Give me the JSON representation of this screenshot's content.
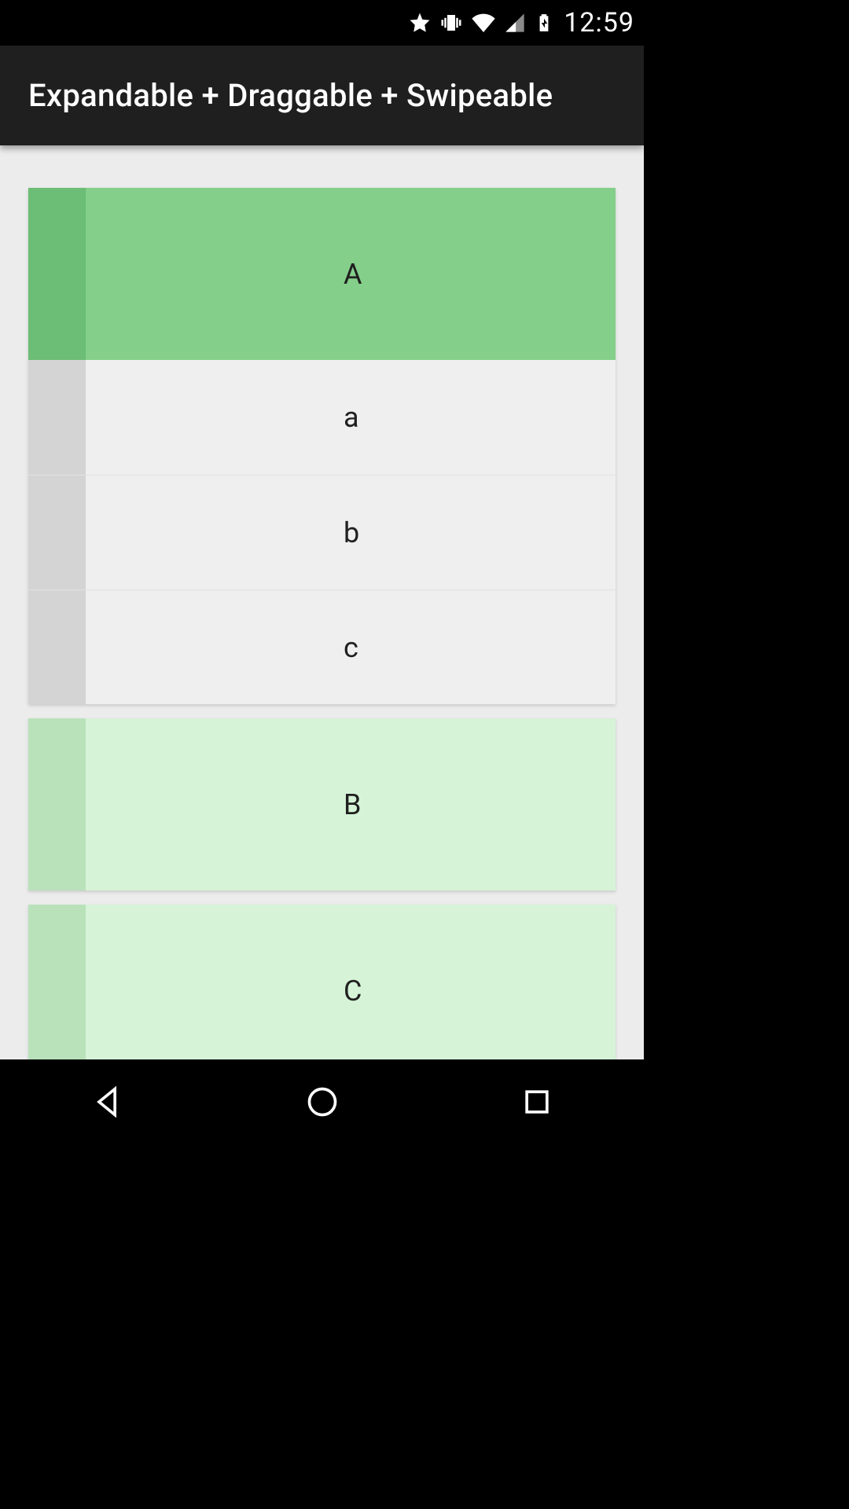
{
  "status": {
    "time": "12:59"
  },
  "appbar": {
    "title": "Expandable + Draggable + Swipeable"
  },
  "groups": [
    {
      "label": "A",
      "expanded": true,
      "children": [
        {
          "label": "a"
        },
        {
          "label": "b"
        },
        {
          "label": "c"
        }
      ]
    },
    {
      "label": "B",
      "expanded": false,
      "children": []
    },
    {
      "label": "C",
      "expanded": false,
      "children": []
    }
  ]
}
